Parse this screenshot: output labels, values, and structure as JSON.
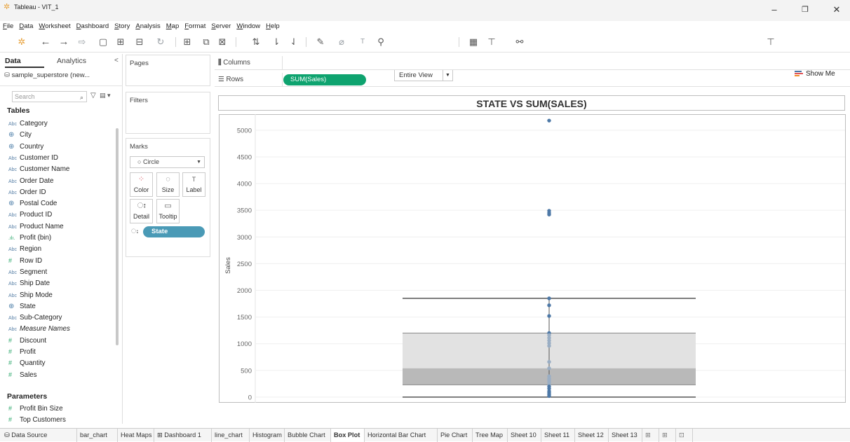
{
  "window": {
    "title": "Tableau - VIT_1",
    "minimize": "–",
    "restore": "❐",
    "close": "✕"
  },
  "menu": [
    "File",
    "Data",
    "Worksheet",
    "Dashboard",
    "Story",
    "Analysis",
    "Map",
    "Format",
    "Server",
    "Window",
    "Help"
  ],
  "toolbar": {
    "fit_select": "Entire View",
    "show_me": "Show Me"
  },
  "data_pane": {
    "tab_data": "Data",
    "tab_analytics": "Analytics",
    "collapse": "<",
    "datasource": "sample_superstore (new...",
    "search_placeholder": "Search",
    "tables_heading": "Tables",
    "fields": [
      {
        "icon": "Abc",
        "name": "Category"
      },
      {
        "icon": "⊕",
        "name": "City"
      },
      {
        "icon": "⊕",
        "name": "Country"
      },
      {
        "icon": "Abc",
        "name": "Customer ID"
      },
      {
        "icon": "Abc",
        "name": "Customer Name"
      },
      {
        "icon": "Abc",
        "name": "Order Date"
      },
      {
        "icon": "Abc",
        "name": "Order ID"
      },
      {
        "icon": "⊕",
        "name": "Postal Code"
      },
      {
        "icon": "Abc",
        "name": "Product ID"
      },
      {
        "icon": "Abc",
        "name": "Product Name"
      },
      {
        "icon": ".ılı.",
        "name": "Profit (bin)"
      },
      {
        "icon": "Abc",
        "name": "Region"
      },
      {
        "icon": "#",
        "name": "Row ID"
      },
      {
        "icon": "Abc",
        "name": "Segment"
      },
      {
        "icon": "Abc",
        "name": "Ship Date"
      },
      {
        "icon": "Abc",
        "name": "Ship Mode"
      },
      {
        "icon": "⊕",
        "name": "State"
      },
      {
        "icon": "Abc",
        "name": "Sub-Category"
      },
      {
        "icon": "Abc",
        "name": "Measure Names"
      },
      {
        "icon": "#",
        "name": "Discount"
      },
      {
        "icon": "#",
        "name": "Profit"
      },
      {
        "icon": "#",
        "name": "Quantity"
      },
      {
        "icon": "#",
        "name": "Sales"
      }
    ],
    "parameters_heading": "Parameters",
    "parameters": [
      {
        "icon": "#",
        "name": "Profit Bin Size"
      },
      {
        "icon": "#",
        "name": "Top Customers"
      }
    ]
  },
  "cards": {
    "pages": "Pages",
    "filters": "Filters",
    "marks": "Marks",
    "mark_type": "Circle",
    "buttons": [
      {
        "glyph": "⁘",
        "label": "Color"
      },
      {
        "glyph": "◌",
        "label": "Size"
      },
      {
        "glyph": "T",
        "label": "Label"
      },
      {
        "glyph": "ഃ",
        "label": "Detail"
      },
      {
        "glyph": "▭",
        "label": "Tooltip"
      }
    ],
    "detail_pill": "State"
  },
  "shelves": {
    "columns_label": "Columns",
    "rows_label": "Rows",
    "rows_pill": "SUM(Sales)"
  },
  "chart_data": {
    "type": "scatter",
    "subtype": "box plot",
    "title": "STATE VS SUM(SALES)",
    "ylabel": "Sales",
    "xlabel": "",
    "ylim": [
      -80,
      5300
    ],
    "yticks": [
      0,
      500,
      1000,
      1500,
      2000,
      2500,
      3000,
      3500,
      4000,
      4500,
      5000
    ],
    "grid": true,
    "box": {
      "whisker_low": 0,
      "q1": 230,
      "median": 540,
      "q3": 1200,
      "whisker_high": 1850
    },
    "points": [
      5180,
      3490,
      3450,
      3420,
      1850,
      1720,
      1520,
      1200,
      1160,
      1110,
      1060,
      1010,
      960,
      660,
      540,
      390,
      350,
      320,
      280,
      240,
      200,
      160,
      110,
      80,
      50,
      20
    ],
    "colors": {
      "point": "#4e79a7",
      "point_light": "#9aaec4",
      "box_outer": "#e2e2e2",
      "box_inner": "#b9b9b9",
      "whisker": "#555555"
    }
  },
  "sheets": {
    "data_source": "Data Source",
    "tabs": [
      "bar_chart",
      "Heat Maps",
      "Dashboard 1",
      "line_chart",
      "Histogram",
      "Bubble Chart",
      "Box Plot",
      "Horizontal Bar Chart",
      "Pie Chart",
      "Tree Map",
      "Sheet 10",
      "Sheet 11",
      "Sheet 12",
      "Sheet 13"
    ],
    "active": "Box Plot"
  }
}
